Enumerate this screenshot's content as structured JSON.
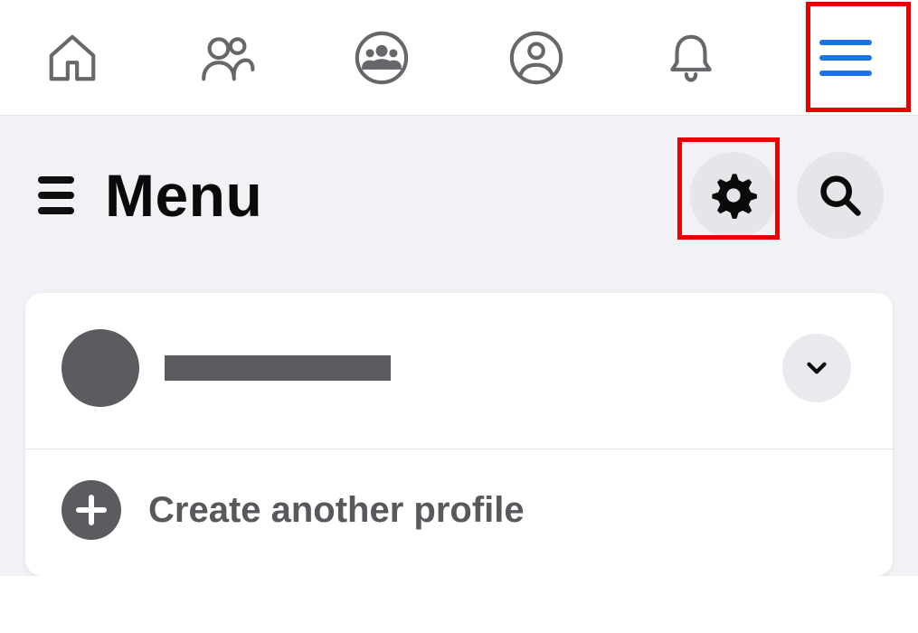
{
  "topnav": {
    "items": [
      {
        "name": "home"
      },
      {
        "name": "friends"
      },
      {
        "name": "groups"
      },
      {
        "name": "profile"
      },
      {
        "name": "notifications"
      },
      {
        "name": "menu"
      }
    ]
  },
  "menu": {
    "title": "Menu",
    "settings_icon": "gear-icon",
    "search_icon": "search-icon"
  },
  "profile": {
    "name_placeholder": "",
    "create_label": "Create another profile"
  },
  "colors": {
    "accent": "#1a74e4",
    "highlight": "#e60000",
    "muted": "#5a5c60"
  }
}
